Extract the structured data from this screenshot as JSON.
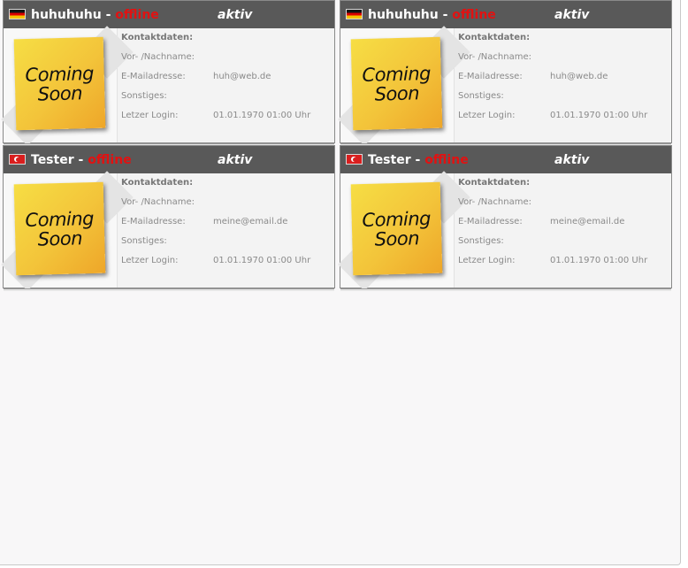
{
  "cards": [
    {
      "flag": "flag-de",
      "name": "huhuhuhu",
      "separator": " - ",
      "status": "offline",
      "state": "aktiv",
      "avatar_line1": "Coming",
      "avatar_line2": "Soon",
      "section_title": "Kontaktdaten:",
      "name_label": "Vor- /Nachname:",
      "name_value": "",
      "email_label": "E-Mailadresse:",
      "email_value": "huh@web.de",
      "misc_label": "Sonstiges:",
      "misc_value": "",
      "login_label": "Letzer Login:",
      "login_value": "01.01.1970 01:00 Uhr"
    },
    {
      "flag": "flag-de",
      "name": "huhuhuhu",
      "separator": " - ",
      "status": "offline",
      "state": "aktiv",
      "avatar_line1": "Coming",
      "avatar_line2": "Soon",
      "section_title": "Kontaktdaten:",
      "name_label": "Vor- /Nachname:",
      "name_value": "",
      "email_label": "E-Mailadresse:",
      "email_value": "huh@web.de",
      "misc_label": "Sonstiges:",
      "misc_value": "",
      "login_label": "Letzer Login:",
      "login_value": "01.01.1970 01:00 Uhr"
    },
    {
      "flag": "flag-tr",
      "name": "Tester",
      "separator": " - ",
      "status": "offline",
      "state": "aktiv",
      "avatar_line1": "Coming",
      "avatar_line2": "Soon",
      "section_title": "Kontaktdaten:",
      "name_label": "Vor- /Nachname:",
      "name_value": "",
      "email_label": "E-Mailadresse:",
      "email_value": "meine@email.de",
      "misc_label": "Sonstiges:",
      "misc_value": "",
      "login_label": "Letzer Login:",
      "login_value": "01.01.1970 01:00 Uhr"
    },
    {
      "flag": "flag-tr",
      "name": "Tester",
      "separator": " - ",
      "status": "offline",
      "state": "aktiv",
      "avatar_line1": "Coming",
      "avatar_line2": "Soon",
      "section_title": "Kontaktdaten:",
      "name_label": "Vor- /Nachname:",
      "name_value": "",
      "email_label": "E-Mailadresse:",
      "email_value": "meine@email.de",
      "misc_label": "Sonstiges:",
      "misc_value": "",
      "login_label": "Letzer Login:",
      "login_value": "01.01.1970 01:00 Uhr"
    }
  ],
  "colors": {
    "header_bg": "#595959",
    "offline": "#e21111",
    "note_yellow": "#f3c43a"
  }
}
